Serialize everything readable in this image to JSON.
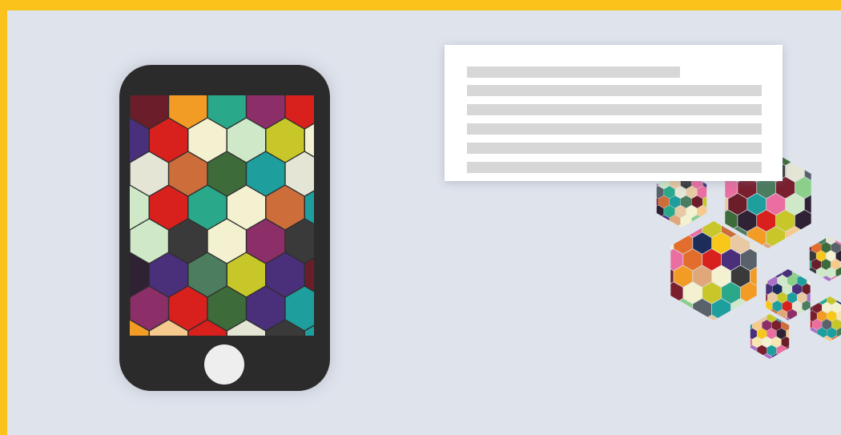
{
  "colors": {
    "frame": "#fbc21b",
    "background": "#dfe3ec",
    "phone_body": "#2b2b2b",
    "home_button": "#eeeeee",
    "card": "#ffffff",
    "placeholder_line": "#d7d7d7"
  },
  "palette": [
    "#e8c9a4",
    "#8ccf8a",
    "#7a1f2e",
    "#3e6b3a",
    "#f4f1d0",
    "#e36d2c",
    "#4a2f7a",
    "#2aa88a",
    "#f7c81a",
    "#3a3a3a",
    "#ea6fa0",
    "#f29c26",
    "#1f9e9e",
    "#c7c72a",
    "#1c2d5a",
    "#cfe8c8",
    "#6b1e2a",
    "#a970c8",
    "#d8201d",
    "#f5ca8c",
    "#59616b",
    "#8c2e68",
    "#f8e6b0",
    "#e0a77a",
    "#4b7d5e",
    "#2f2235",
    "#e5e5d6",
    "#cc6d3a"
  ],
  "text_card": {
    "line_count": 6
  }
}
